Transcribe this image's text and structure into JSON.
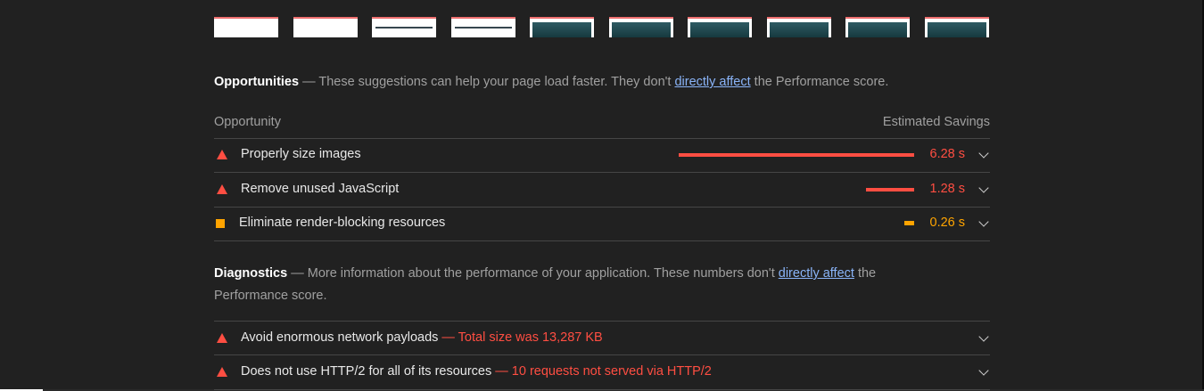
{
  "filmstrip": {
    "frames": [
      {
        "style": "blank"
      },
      {
        "style": "blank"
      },
      {
        "style": "header"
      },
      {
        "style": "header"
      },
      {
        "style": "dark"
      },
      {
        "style": "dark"
      },
      {
        "style": "dark"
      },
      {
        "style": "dark"
      },
      {
        "style": "dark"
      },
      {
        "style": "dark"
      }
    ]
  },
  "opportunities": {
    "title": "Opportunities",
    "desc_prefix": " — These suggestions can help your page load faster. They don't ",
    "link": "directly affect",
    "desc_suffix": " the Performance score.",
    "col_left": "Opportunity",
    "col_right": "Estimated Savings",
    "items": [
      {
        "label": "Properly size images",
        "value": "6.28 s",
        "severity": "fail",
        "icon": "triangle-warning-icon",
        "savings_ratio": 1.0
      },
      {
        "label": "Remove unused JavaScript",
        "value": "1.28 s",
        "severity": "fail",
        "icon": "triangle-warning-icon",
        "savings_ratio": 0.204
      },
      {
        "label": "Eliminate render-blocking resources",
        "value": "0.26 s",
        "severity": "average",
        "icon": "square-warning-icon",
        "savings_ratio": 0.042
      }
    ]
  },
  "diagnostics": {
    "title": "Diagnostics",
    "desc_prefix": " — More information about the performance of your application. These numbers don't ",
    "link": "directly affect",
    "desc_suffix_1": " the",
    "desc_line2": "Performance score.",
    "items": [
      {
        "label": "Avoid enormous network payloads",
        "detail": " — Total size was 13,287 KB",
        "icon": "triangle-warning-icon"
      },
      {
        "label": "Does not use HTTP/2 for all of its resources",
        "detail": " — 10 requests not served via HTTP/2",
        "icon": "triangle-warning-icon"
      }
    ]
  },
  "colors": {
    "background": "#212121",
    "fail": "#ff4e42",
    "average": "#ffa400",
    "link": "#8ab4f8"
  }
}
